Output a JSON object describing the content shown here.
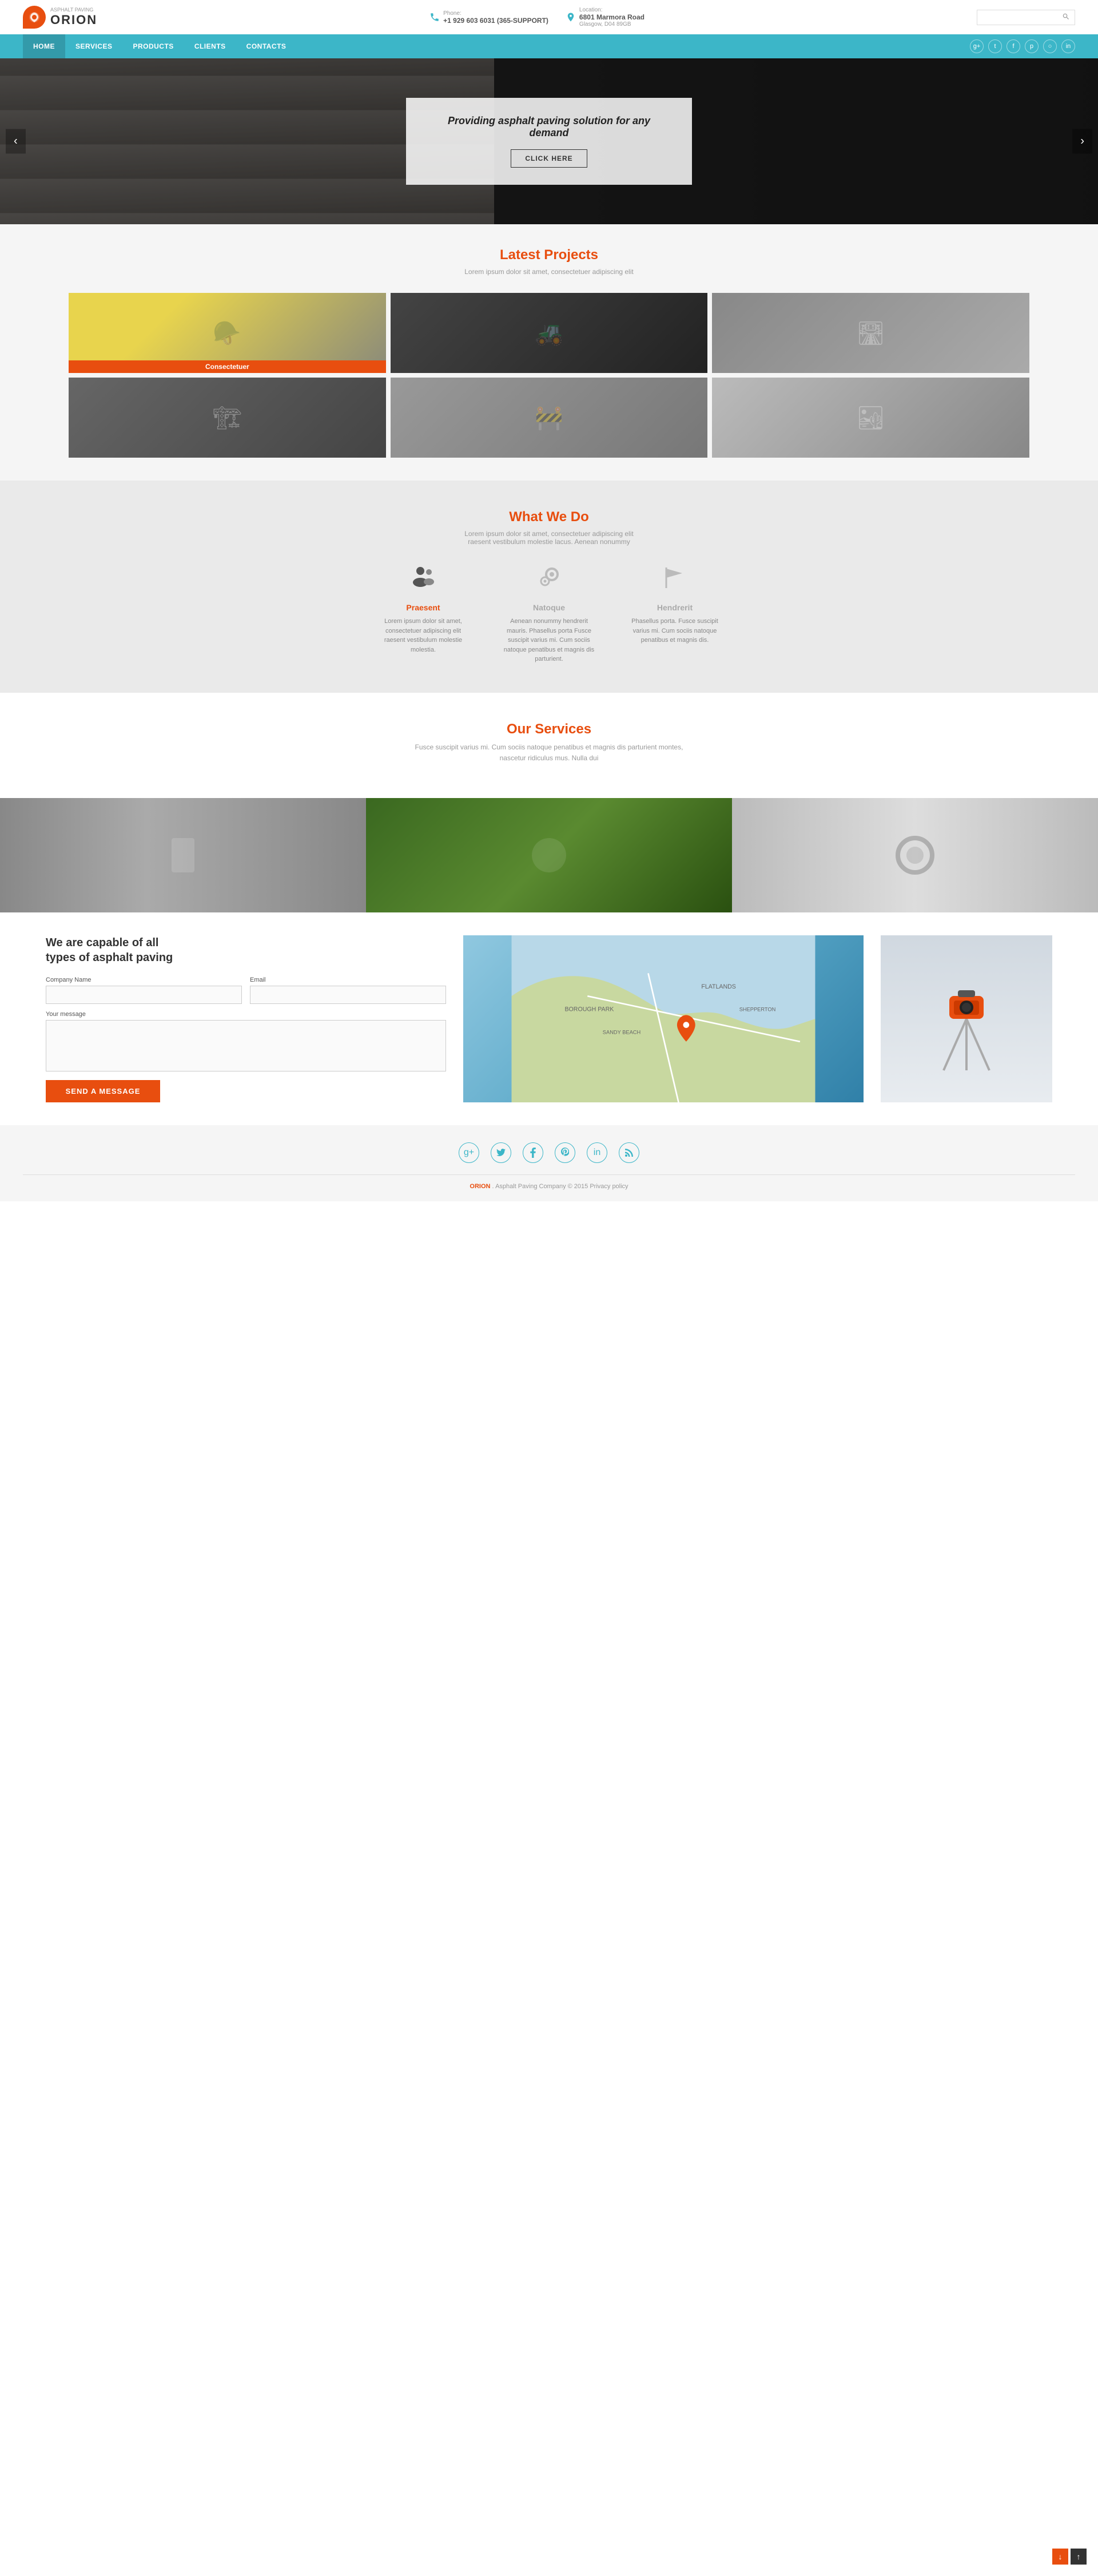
{
  "brand": {
    "top_text": "Asphalt paving",
    "name": "ORION"
  },
  "header": {
    "phone_label": "Phone:",
    "phone_number": "+1 929 603 6031 (365-SUPPORT)",
    "location_label": "Location:",
    "location_address": "6801 Marmora Road",
    "location_city": "Glasgow, D04 89GB",
    "search_placeholder": ""
  },
  "nav": {
    "links": [
      {
        "label": "HOME",
        "active": true
      },
      {
        "label": "SERVICES",
        "active": false
      },
      {
        "label": "PRODUCTS",
        "active": false
      },
      {
        "label": "CLIENTS",
        "active": false
      },
      {
        "label": "CONTACTS",
        "active": false
      }
    ]
  },
  "hero": {
    "tagline": "Providing asphalt paving solution for any demand",
    "cta_button": "CLICK HERE"
  },
  "latest_projects": {
    "title": "Latest Projects",
    "subtitle": "Lorem ipsum dolor sit amet, consectetuer adipiscing elit",
    "items": [
      {
        "label": "Consectetuer",
        "active": true
      },
      {
        "label": "",
        "active": false
      },
      {
        "label": "",
        "active": false
      },
      {
        "label": "",
        "active": false
      },
      {
        "label": "",
        "active": false
      },
      {
        "label": "",
        "active": false
      }
    ]
  },
  "what_we_do": {
    "title": "What We Do",
    "subtitle": "Lorem ipsum dolor sit amet, consectetuer adipiscing elit\nraesent vestibulum molestie lacus. Aenean nonummy",
    "services": [
      {
        "icon": "users",
        "name": "Praesent",
        "color": "orange",
        "description": "Lorem ipsum dolor sit amet, consectetuer adipiscing elit raesent vestibulum molestie molestia."
      },
      {
        "icon": "gears",
        "name": "Natoque",
        "color": "gray",
        "description": "Aenean nonummy hendrerit mauris. Phasellus porta Fusce suscipit varius mi. Cum sociis natoque penatibus et magnis dis parturient."
      },
      {
        "icon": "flag",
        "name": "Hendrerit",
        "color": "gray",
        "description": "Phasellus porta. Fusce suscipit varius mi. Cum sociis natoque penatibus et magnis dis."
      }
    ]
  },
  "our_services": {
    "title": "Our Services",
    "description": "Fusce suscipit varius mi. Cum sociis natoque penatibus et magnis dis parturient montes, nascetur ridiculus mus. Nulla dui"
  },
  "contact": {
    "heading_line1": "We are capable of all",
    "heading_line2": "types of asphalt paving",
    "company_name_label": "Company Name",
    "email_label": "Email",
    "message_label": "Your message",
    "send_button": "SEND A MESSAGE"
  },
  "footer": {
    "social_icons": [
      {
        "icon": "g+",
        "label": "google-plus"
      },
      {
        "icon": "𝕏",
        "label": "twitter"
      },
      {
        "icon": "f",
        "label": "facebook"
      },
      {
        "icon": "P",
        "label": "pinterest"
      },
      {
        "icon": "in",
        "label": "linkedin"
      },
      {
        "icon": "⊡",
        "label": "rss"
      }
    ],
    "copyright": "Asphalt Paving Company © 2015 Privacy policy",
    "brand": "ORION"
  }
}
